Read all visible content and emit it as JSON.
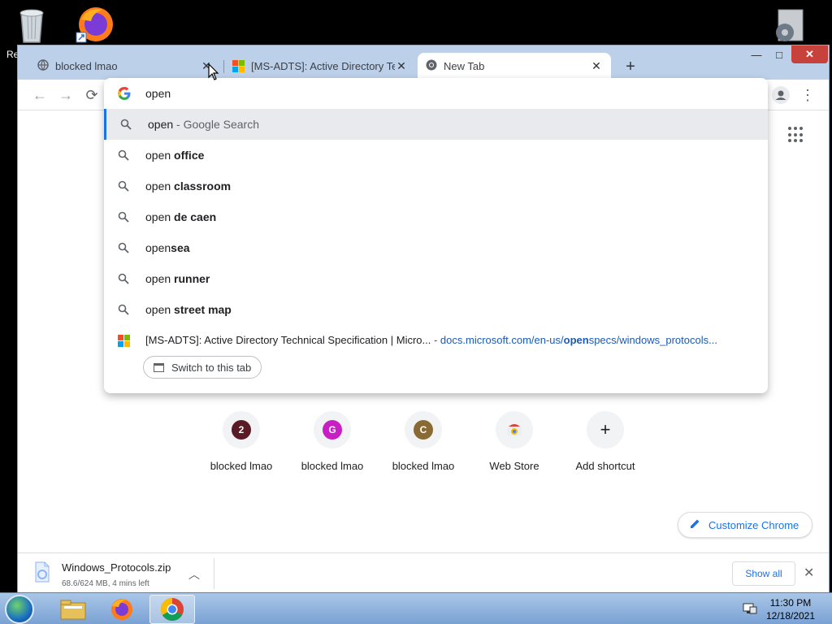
{
  "desktop": {
    "partial_label": "Re",
    "icons": [
      "recycle-bin-icon",
      "firefox-icon",
      "settings-icon"
    ]
  },
  "browser": {
    "tabs": [
      {
        "title": "blocked lmao",
        "icon": "globe-icon",
        "active": false
      },
      {
        "title": "[MS-ADTS]: Active Directory Tech",
        "icon": "microsoft-icon",
        "active": false
      },
      {
        "title": "New Tab",
        "icon": "chrome-icon",
        "active": true
      }
    ],
    "window_controls": {
      "minimize": "—",
      "maximize": "□",
      "close": "✕"
    },
    "new_tab_label": "+"
  },
  "omnibox": {
    "input_value": "open",
    "suggestions": [
      {
        "prefix": "open",
        "rest": " - Google Search",
        "style": "grey",
        "selected": true
      },
      {
        "prefix": "open ",
        "rest": "office",
        "style": "bold"
      },
      {
        "prefix": "open ",
        "rest": "classroom",
        "style": "bold"
      },
      {
        "prefix": "open ",
        "rest": "de caen",
        "style": "bold"
      },
      {
        "prefix": "open",
        "rest": "sea",
        "style": "bold"
      },
      {
        "prefix": "open ",
        "rest": "runner",
        "style": "bold"
      },
      {
        "prefix": "open ",
        "rest": "street map",
        "style": "bold"
      }
    ],
    "tab_match": {
      "title": "[MS-ADTS]: Active Directory Technical Specification | Micro...",
      "separator": " - ",
      "url_before": "docs.microsoft.com/en-us/",
      "url_match": "open",
      "url_after": "specs/windows_protocols..."
    },
    "switch_tab_label": "Switch to this tab"
  },
  "shortcuts": [
    {
      "letter": "2",
      "label": "blocked lmao",
      "color": "#5a1a26"
    },
    {
      "letter": "G",
      "label": "blocked lmao",
      "color": "#c71fc3"
    },
    {
      "letter": "C",
      "label": "blocked lmao",
      "color": "#8a6a33"
    },
    {
      "letter": "",
      "label": "Web Store",
      "color": ""
    },
    {
      "letter": "+",
      "label": "Add shortcut",
      "color": ""
    }
  ],
  "customize_label": "Customize Chrome",
  "download": {
    "filename": "Windows_Protocols.zip",
    "status": "68.6/624 MB, 4 mins left",
    "show_all_label": "Show all"
  },
  "taskbar": {
    "time": "11:30 PM",
    "date": "12/18/2021"
  },
  "colors": {
    "accent": "#1a73e8",
    "tabstrip": "#bdd0ea"
  }
}
